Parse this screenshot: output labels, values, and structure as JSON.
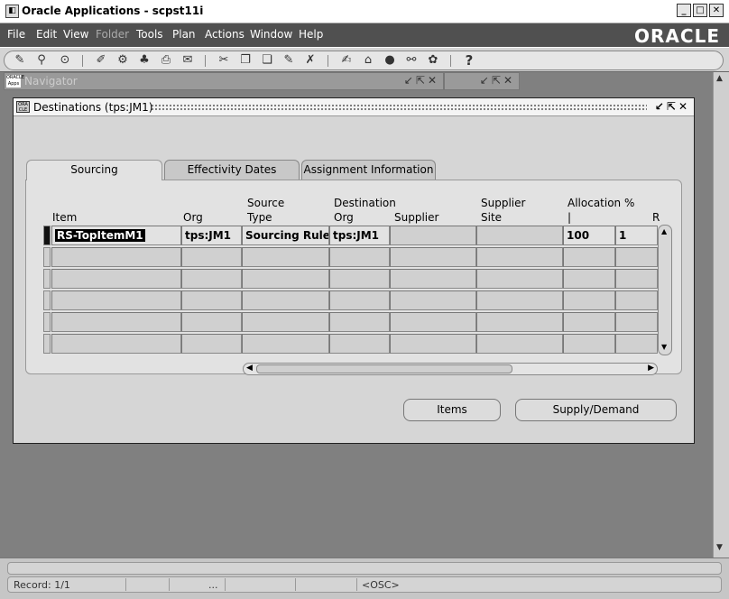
{
  "window": {
    "title": "Oracle Applications - scpst11i"
  },
  "menubar": {
    "items": [
      "File",
      "Edit",
      "View",
      "Folder",
      "Tools",
      "Plan",
      "Actions",
      "Window",
      "Help"
    ],
    "logo": "ORACLE"
  },
  "navigator": {
    "title": "Navigator"
  },
  "destinations": {
    "title": "Destinations (tps:JM1)",
    "tabs": [
      "Sourcing",
      "Effectivity Dates",
      "Assignment Information"
    ],
    "headers": {
      "item": "Item",
      "org": "Org",
      "source_type": [
        "Source",
        "Type"
      ],
      "dest_org": [
        "Destination",
        "Org"
      ],
      "supplier": "Supplier",
      "supplier_site": [
        "Supplier",
        "Site"
      ],
      "allocation": [
        "Allocation %",
        "|"
      ],
      "rank": "R"
    },
    "rows": [
      {
        "item": "RS-TopItemM1",
        "org": "tps:JM1",
        "source_type": "Sourcing Rule",
        "dest_org": "tps:JM1",
        "supplier": "",
        "supplier_site": "",
        "allocation": "100",
        "rank": "1"
      }
    ],
    "buttons": {
      "items": "Items",
      "supply_demand": "Supply/Demand"
    }
  },
  "statusbar": {
    "record": "Record: 1/1",
    "ellipsis": "...",
    "osc": "<OSC>"
  }
}
